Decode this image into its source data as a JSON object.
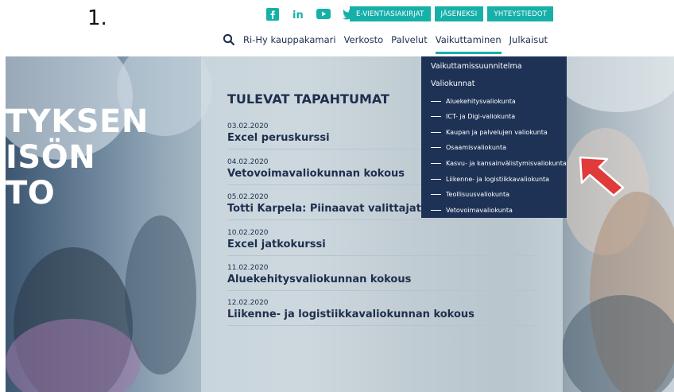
{
  "step_number": "1.",
  "social": [
    "facebook-icon",
    "linkedin-icon",
    "youtube-icon",
    "twitter-icon"
  ],
  "top_buttons": [
    "E-VIENTIASIAKIRJAT",
    "JÄSENEKSI",
    "YHTEYSTIEDOT"
  ],
  "nav": {
    "items": [
      "Ri-Hy kauppakamari",
      "Verkosto",
      "Palvelut",
      "Vaikuttaminen",
      "Julkaisut"
    ],
    "active": "Vaikuttaminen"
  },
  "hero": {
    "lines": [
      "TYKSEN",
      "ISÖN",
      "TO"
    ]
  },
  "events": {
    "title": "TULEVAT TAPAHTUMAT",
    "items": [
      {
        "date": "03.02.2020",
        "title": "Excel peruskurssi"
      },
      {
        "date": "04.02.2020",
        "title": "Vetovoimavaliokunnan kokous"
      },
      {
        "date": "05.02.2020",
        "title": "Totti Karpela: Piinaavat valittajat – stri"
      },
      {
        "date": "10.02.2020",
        "title": "Excel jatkokurssi"
      },
      {
        "date": "11.02.2020",
        "title": "Aluekehitysvaliokunnan kokous"
      },
      {
        "date": "12.02.2020",
        "title": "Liikenne- ja logistiikkavaliokunnan kokous"
      }
    ]
  },
  "dropdown": {
    "heading1": "Vaikuttamissuunnitelma",
    "heading2": "Valiokunnat",
    "items": [
      "Aluekehitysvaliokunta",
      "ICT- ja Digi-valiokunta",
      "Kaupan ja palvelujen valiokunta",
      "Osaamisvaliokunta",
      "Kasvu- ja kansainvälistymisvaliokunta",
      "Liikenne- ja logistiikkavaliokunta",
      "Teollisuusvaliokunta",
      "Vetovoimavaliokunta"
    ]
  },
  "colors": {
    "teal": "#17b0a8",
    "navy": "#1e3256",
    "arrow": "#e03a3a"
  }
}
